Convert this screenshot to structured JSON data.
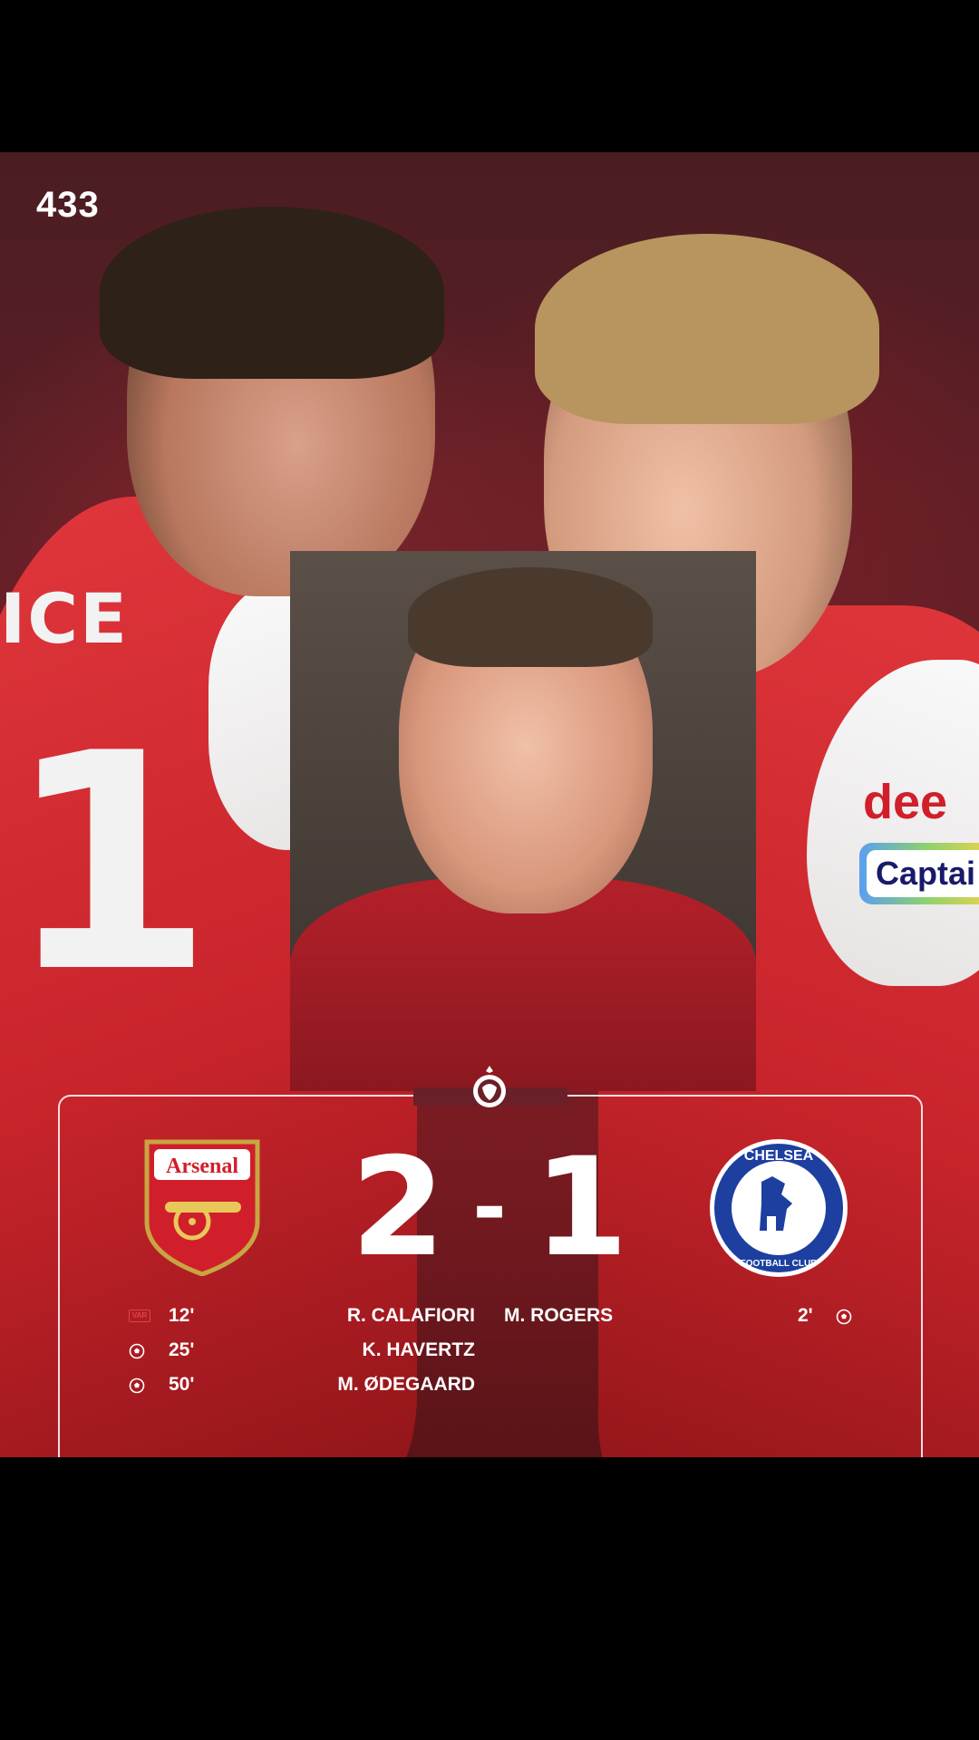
{
  "brand": {
    "logo": "433"
  },
  "background": {
    "left_player_name": "ICE",
    "left_player_number": "1",
    "right_sponsor": "dee",
    "right_captain_band": "Captai"
  },
  "match": {
    "competition_icon": "premier-league-lion-icon",
    "home_team": {
      "name": "Arsenal",
      "crest_icon": "arsenal-crest-icon"
    },
    "away_team": {
      "name": "CHELSEA",
      "sub": "FOOTBALL CLUB",
      "crest_icon": "chelsea-crest-icon"
    },
    "score": {
      "home": "2",
      "separator": "-",
      "away": "1"
    },
    "home_events": [
      {
        "type": "var-goal",
        "minute": "12'",
        "player": "R. CALAFIORI"
      },
      {
        "type": "goal",
        "minute": "25'",
        "player": "K. HAVERTZ"
      },
      {
        "type": "goal",
        "minute": "50'",
        "player": "M. ØDEGAARD"
      }
    ],
    "away_events": [
      {
        "type": "goal",
        "minute": "2'",
        "player": "M. ROGERS"
      }
    ],
    "var_label": "VAR"
  },
  "colors": {
    "arsenal_red": "#d01f2b",
    "chelsea_blue": "#1d3fa0",
    "panel_border": "#ffffff"
  }
}
